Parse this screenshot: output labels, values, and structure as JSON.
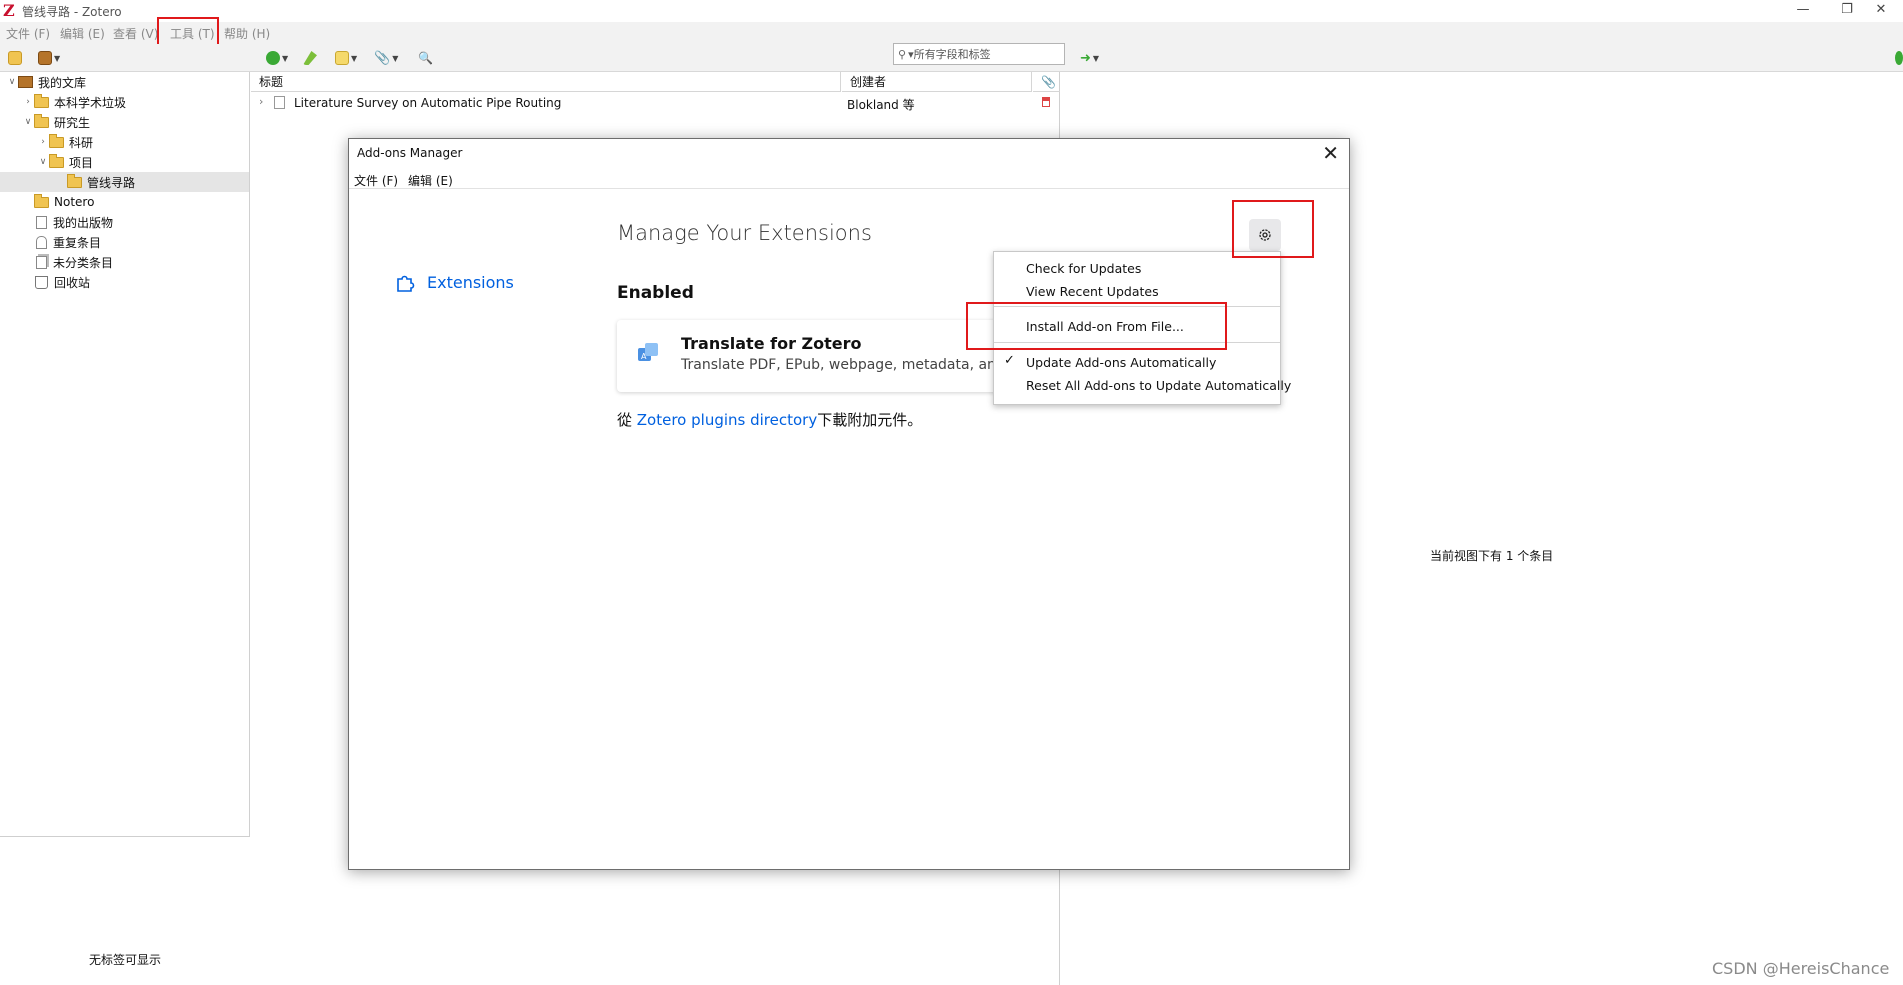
{
  "window": {
    "title": "管线寻路 - Zotero",
    "logo": "Z"
  },
  "menubar": [
    "文件 (F)",
    "编辑 (E)",
    "查看 (V)",
    "工具 (T)",
    "帮助 (H)"
  ],
  "search": {
    "placeholder": "▾所有字段和标签"
  },
  "tree": [
    {
      "label": "我的文库",
      "icon": "library-icon"
    },
    {
      "label": "本科学术垃圾",
      "icon": "folder-icon"
    },
    {
      "label": "研究生",
      "icon": "folder-icon"
    },
    {
      "label": "科研",
      "icon": "folder-icon"
    },
    {
      "label": "项目",
      "icon": "folder-icon"
    },
    {
      "label": "管线寻路",
      "icon": "folder-icon"
    },
    {
      "label": "Notero",
      "icon": "folder-icon"
    },
    {
      "label": "我的出版物",
      "icon": "document-icon"
    },
    {
      "label": "重复条目",
      "icon": "duplicate-icon"
    },
    {
      "label": "未分类条目",
      "icon": "unfiled-icon"
    },
    {
      "label": "回收站",
      "icon": "trash-icon"
    }
  ],
  "tag_pane": {
    "message": "无标签可显示"
  },
  "items": {
    "columns": [
      "标题",
      "创建者"
    ],
    "rows": [
      {
        "title": "Literature Survey on Automatic Pipe Routing",
        "creator": "Blokland 等"
      }
    ]
  },
  "right_pane": {
    "message": "当前视图下有 1 个条目"
  },
  "dialog": {
    "title": "Add-ons Manager",
    "menubar": [
      "文件 (F)",
      "编辑 (E)"
    ],
    "nav_extensions": "Extensions",
    "heading": "Manage Your Extensions",
    "section": "Enabled",
    "addon": {
      "name": "Translate for Zotero",
      "description": "Translate PDF, EPub, webpage, metadata, anno"
    },
    "footer": {
      "prefix": "從 ",
      "link": "Zotero plugins directory",
      "suffix": "下載附加元件。"
    }
  },
  "popup_menu": {
    "items": [
      "Check for Updates",
      "View Recent Updates",
      "Install Add-on From File...",
      "Update Add-ons Automatically",
      "Reset All Add-ons to Update Automatically"
    ],
    "checked": "Update Add-ons Automatically"
  },
  "watermark": "CSDN @HereisChance",
  "colors": {
    "highlight_box": "#e0191b",
    "link": "#0060df"
  }
}
